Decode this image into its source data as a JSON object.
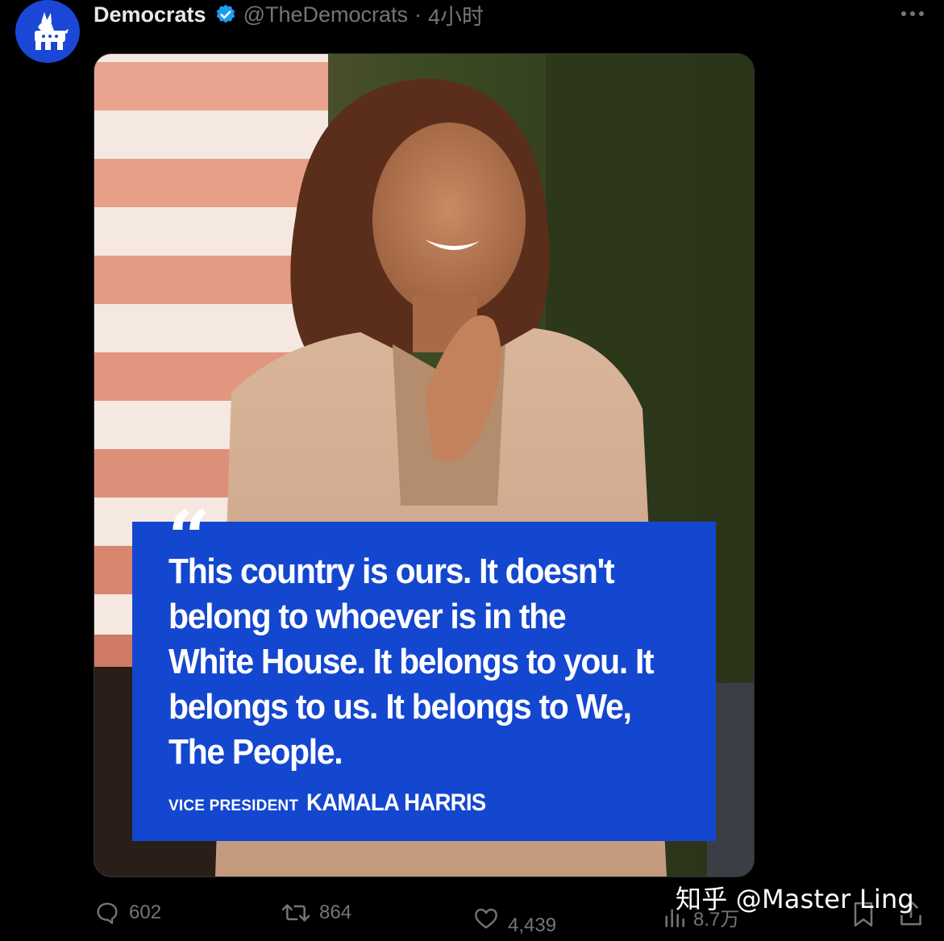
{
  "post": {
    "author": {
      "display_name": "Democrats",
      "handle": "@TheDemocrats",
      "verified": true,
      "avatar_icon": "donkey-logo-icon"
    },
    "separator": "·",
    "time": "4小时",
    "more_icon": "more-dots-icon"
  },
  "media": {
    "quote_mark": "“",
    "quote_text": "This country is ours. It doesn't belong to whoever is in the White House. It belongs to you. It belongs to us. It belongs to We, The People.",
    "attribution_title": "VICE PRESIDENT",
    "attribution_name": "KAMALA HARRIS"
  },
  "actions": {
    "reply_count": "602",
    "retweet_count": "864",
    "like_count": "4,439",
    "views_count": "8.7万"
  },
  "watermark": "知乎 @Master Ling",
  "colors": {
    "background": "#000000",
    "accent_blue": "#1d9bf0",
    "quote_box": "#1447cf",
    "muted_text": "#71767b",
    "avatar_bg": "#1a47d6"
  }
}
